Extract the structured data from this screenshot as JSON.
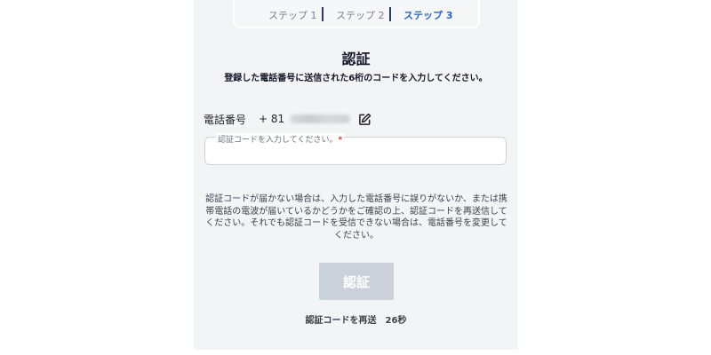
{
  "steps": [
    {
      "label": "ステップ 1",
      "active": false
    },
    {
      "label": "ステップ 2",
      "active": false
    },
    {
      "label": "ステップ 3",
      "active": true
    }
  ],
  "header": {
    "title": "認証",
    "subtitle": "登録した電話番号に送信された6桁のコードを入力してください。"
  },
  "phone": {
    "label": "電話番号",
    "country_code": "+ 81",
    "edit_icon": "edit-icon"
  },
  "code_field": {
    "label": "認証コードを入力してください。",
    "required_mark": "*",
    "value": ""
  },
  "notice": "認証コードが届かない場合は、入力した電話番号に誤りがないか、または携帯電話の電波が届いているかどうかをご確認の上、認証コードを再送信してください。それでも認証コードを受信できない場合は、電話番号を変更してください。",
  "submit_button": {
    "label": "認証",
    "enabled": false
  },
  "resend": {
    "label": "認証コードを再送",
    "countdown": "26秒"
  },
  "colors": {
    "panel_bg": "#f3f4f6",
    "active_step": "#2a66c9",
    "divider": "#2a3b66",
    "button_disabled_bg": "#cbd1db",
    "required": "#d2322d"
  }
}
